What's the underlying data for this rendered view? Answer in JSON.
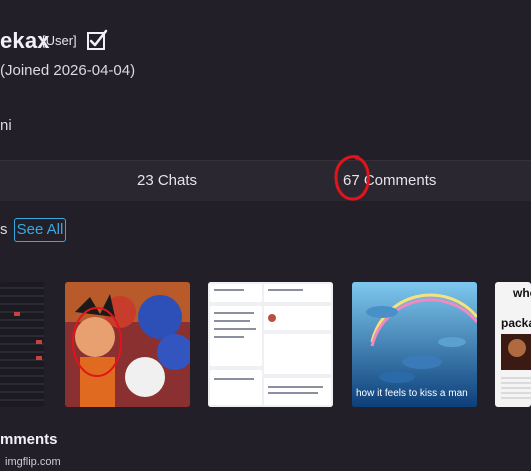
{
  "profile": {
    "username": "ekax",
    "role": "[User]",
    "joined": "(Joined 2026-04-04)",
    "bio": "ni"
  },
  "stats": {
    "chats": "23 Chats",
    "comments": "67 Comments"
  },
  "section": {
    "label": "s",
    "see_all": "See All"
  },
  "thumbnails": {
    "t4_caption": "how it feels to kiss a man",
    "t5_word1": "whe",
    "t5_word2": "packa"
  },
  "comments_section": {
    "title": "mments"
  },
  "watermark": "imgflip.com",
  "colors": {
    "background": "#231f29",
    "stats_bar": "#2b2731",
    "link": "#38a9e0",
    "annotation": "#e0151b"
  }
}
